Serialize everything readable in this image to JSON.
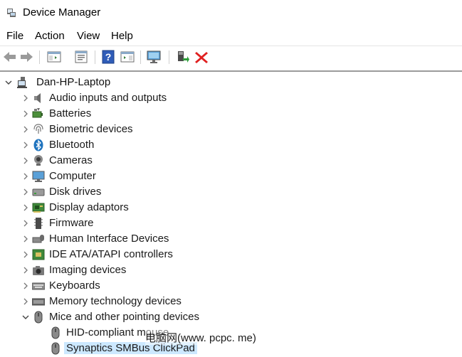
{
  "window": {
    "title": "Device Manager"
  },
  "menubar": [
    {
      "id": "file",
      "label": "File"
    },
    {
      "id": "action",
      "label": "Action"
    },
    {
      "id": "view",
      "label": "View"
    },
    {
      "id": "help",
      "label": "Help"
    }
  ],
  "toolbar": [
    {
      "id": "back",
      "icon": "arrow-left-icon"
    },
    {
      "id": "forward",
      "icon": "arrow-right-icon"
    },
    {
      "id": "show-hide-console-tree",
      "icon": "console-tree-icon"
    },
    {
      "id": "properties",
      "icon": "properties-icon"
    },
    {
      "id": "help",
      "icon": "help-icon"
    },
    {
      "id": "show-action-pane",
      "icon": "action-pane-icon"
    },
    {
      "id": "scan-hardware",
      "icon": "monitor-scan-icon"
    },
    {
      "id": "update-driver",
      "icon": "update-driver-icon"
    },
    {
      "id": "uninstall-device",
      "icon": "red-x-icon"
    }
  ],
  "tree": {
    "root": {
      "label": "Dan-HP-Laptop",
      "icon": "computer-tower-icon",
      "expanded": true
    },
    "categories": [
      {
        "id": "audio",
        "label": "Audio inputs and outputs",
        "icon": "speaker-icon"
      },
      {
        "id": "batteries",
        "label": "Batteries",
        "icon": "battery-icon"
      },
      {
        "id": "biometric",
        "label": "Biometric devices",
        "icon": "fingerprint-icon"
      },
      {
        "id": "bluetooth",
        "label": "Bluetooth",
        "icon": "bluetooth-icon"
      },
      {
        "id": "cameras",
        "label": "Cameras",
        "icon": "camera-icon"
      },
      {
        "id": "computer",
        "label": "Computer",
        "icon": "monitor-icon"
      },
      {
        "id": "disk",
        "label": "Disk drives",
        "icon": "disk-drive-icon"
      },
      {
        "id": "display",
        "label": "Display adaptors",
        "icon": "display-adapter-icon"
      },
      {
        "id": "firmware",
        "label": "Firmware",
        "icon": "firmware-icon"
      },
      {
        "id": "hid",
        "label": "Human Interface Devices",
        "icon": "hid-icon"
      },
      {
        "id": "ide",
        "label": "IDE ATA/ATAPI controllers",
        "icon": "ide-controller-icon"
      },
      {
        "id": "imaging",
        "label": "Imaging devices",
        "icon": "camera-icon"
      },
      {
        "id": "keyboards",
        "label": "Keyboards",
        "icon": "keyboard-icon"
      },
      {
        "id": "memory",
        "label": "Memory technology devices",
        "icon": "memory-icon"
      },
      {
        "id": "mice",
        "label": "Mice and other pointing devices",
        "icon": "mouse-icon",
        "expanded": true,
        "children": [
          {
            "id": "hid-mouse",
            "label": "HID-compliant mouse",
            "icon": "mouse-icon"
          },
          {
            "id": "synaptics",
            "label": "Synaptics SMBus ClickPad",
            "icon": "mouse-icon",
            "selected": true
          }
        ]
      }
    ]
  },
  "watermark": {
    "text": "电脑网(www. pcpc. me)"
  },
  "colors": {
    "selection": "#cce8ff",
    "accent_blue": "#1e73be",
    "delete_red": "#e02020",
    "frame_border": "#9b9b9b"
  }
}
